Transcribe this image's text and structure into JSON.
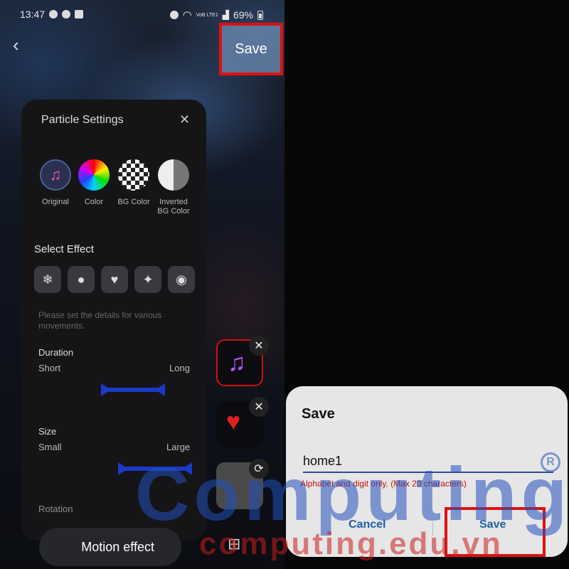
{
  "status_bar": {
    "time": "13:47",
    "network": "VoB LTE1",
    "battery": "69%"
  },
  "header": {
    "back_icon": "back-arrow-icon",
    "save_label": "Save"
  },
  "particle_settings": {
    "title": "Particle Settings",
    "options": [
      {
        "label": "Original",
        "icon": "music-note-icon"
      },
      {
        "label": "Color",
        "icon": "color-wheel-icon"
      },
      {
        "label": "BG Color",
        "icon": "checker-icon"
      },
      {
        "label": "Inverted\nBG Color",
        "icon": "half-circle-icon"
      }
    ],
    "select_effect_title": "Select Effect",
    "effects": [
      "snowflake-icon",
      "drop-icon",
      "heart-icon",
      "sparkle-icon",
      "bubble-icon"
    ],
    "hint": "Please set the details for various movements.",
    "duration": {
      "label": "Duration",
      "min": "Short",
      "max": "Long"
    },
    "size": {
      "label": "Size",
      "min": "Small",
      "max": "Large"
    },
    "next_label": "Rotation"
  },
  "motion_button": {
    "label": "Motion effect"
  },
  "save_dialog": {
    "title": "Save",
    "input_value": "home1",
    "error": "Alphabet and digit only. (Max 20 characters)",
    "cancel_label": "Cancel",
    "save_label": "Save"
  },
  "watermark": {
    "main": "Computing",
    "sub": "computing.edu.vn"
  },
  "colors": {
    "highlight": "#e01010",
    "accent_blue": "#1f5fa8",
    "slider": "#1a3ac8"
  }
}
